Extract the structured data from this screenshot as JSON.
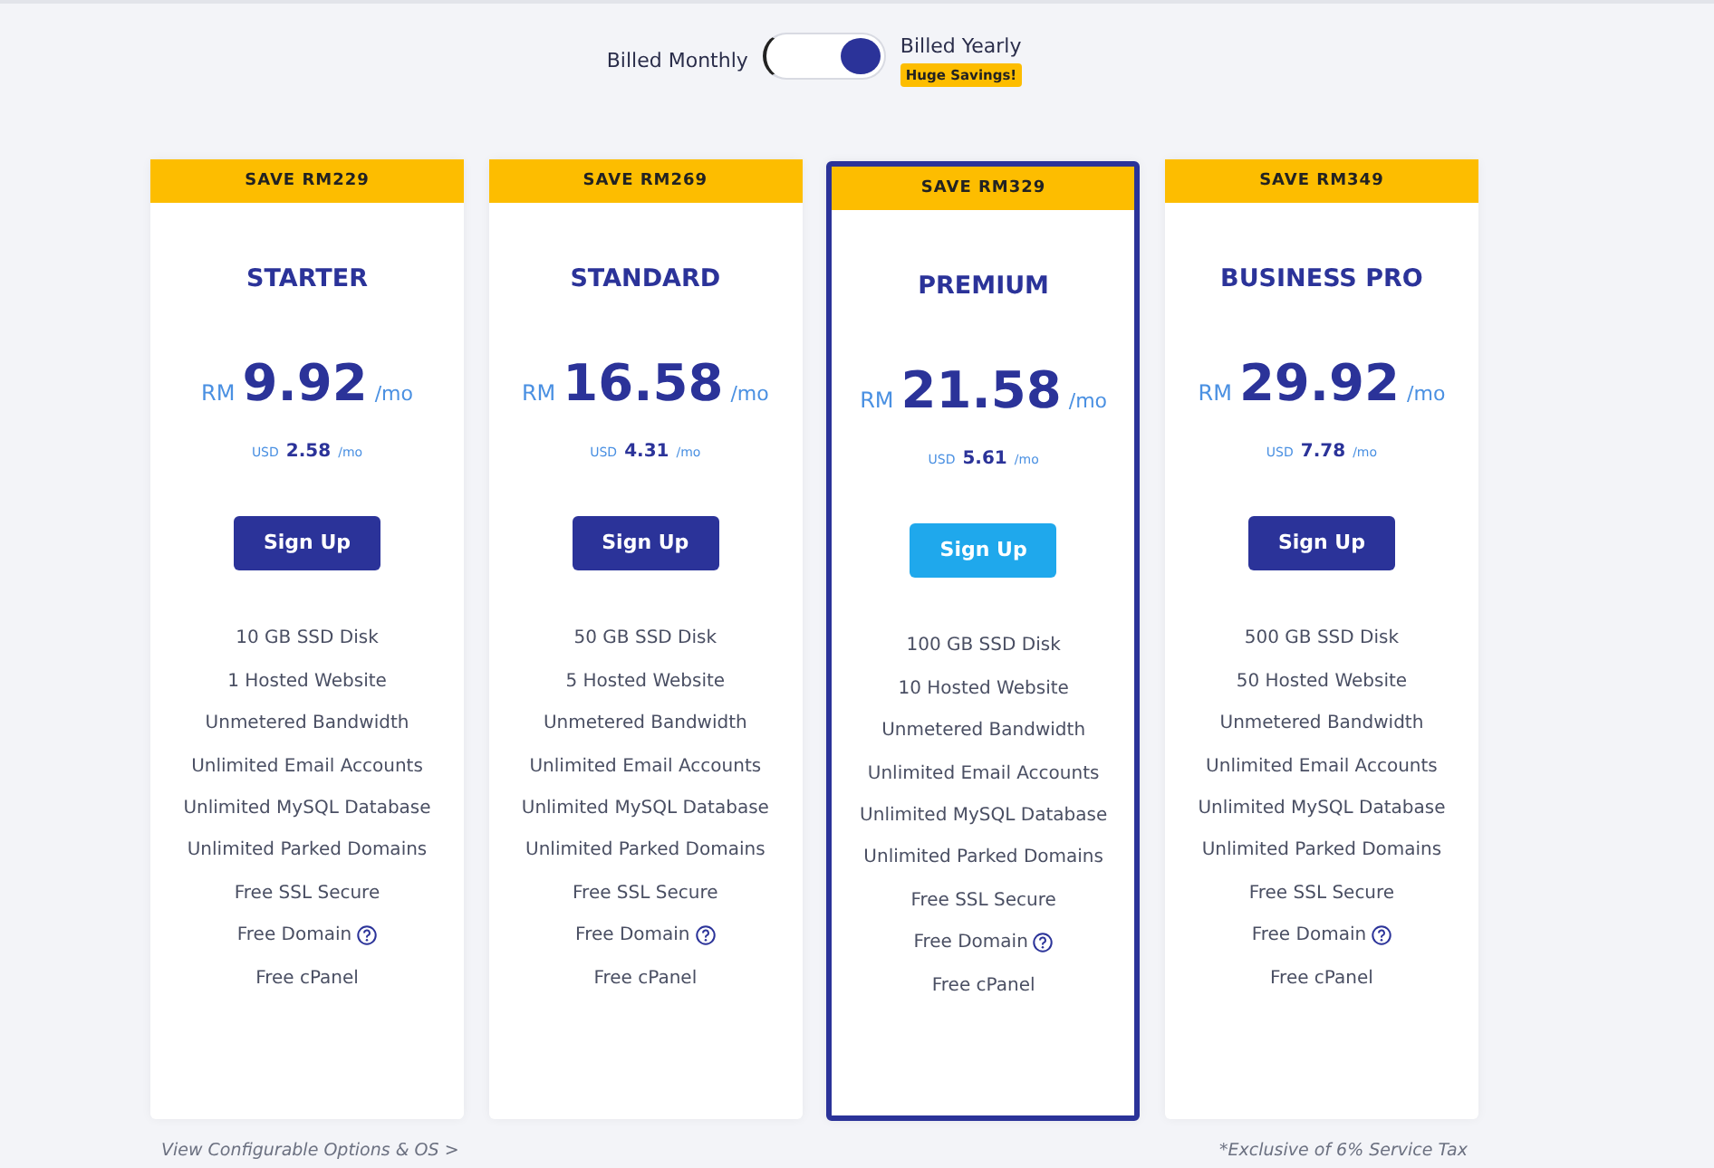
{
  "billing": {
    "monthly_label": "Billed Monthly",
    "yearly_label": "Billed Yearly",
    "yearly_on": true,
    "savings_badge": "Huge Savings!"
  },
  "plans": [
    {
      "save": "SAVE RM229",
      "name": "STARTER",
      "currency": "RM",
      "price": "9.92",
      "period": "/mo",
      "usd_label": "USD",
      "usd_price": "2.58",
      "usd_period": "/mo",
      "button": "Sign Up",
      "selected": false,
      "features": [
        {
          "text": "10 GB SSD Disk",
          "help": false
        },
        {
          "text": "1 Hosted Website",
          "help": false
        },
        {
          "text": "Unmetered Bandwidth",
          "help": false
        },
        {
          "text": "Unlimited Email Accounts",
          "help": false
        },
        {
          "text": "Unlimited MySQL Database",
          "help": false
        },
        {
          "text": "Unlimited Parked Domains",
          "help": false
        },
        {
          "text": "Free SSL Secure",
          "help": false
        },
        {
          "text": "Free Domain",
          "help": true
        },
        {
          "text": "Free cPanel",
          "help": false
        }
      ]
    },
    {
      "save": "SAVE RM269",
      "name": "STANDARD",
      "currency": "RM",
      "price": "16.58",
      "period": "/mo",
      "usd_label": "USD",
      "usd_price": "4.31",
      "usd_period": "/mo",
      "button": "Sign Up",
      "selected": false,
      "features": [
        {
          "text": "50 GB SSD Disk",
          "help": false
        },
        {
          "text": "5 Hosted Website",
          "help": false
        },
        {
          "text": "Unmetered Bandwidth",
          "help": false
        },
        {
          "text": "Unlimited Email Accounts",
          "help": false
        },
        {
          "text": "Unlimited MySQL Database",
          "help": false
        },
        {
          "text": "Unlimited Parked Domains",
          "help": false
        },
        {
          "text": "Free SSL Secure",
          "help": false
        },
        {
          "text": "Free Domain",
          "help": true
        },
        {
          "text": "Free cPanel",
          "help": false
        }
      ]
    },
    {
      "save": "SAVE RM329",
      "name": "PREMIUM",
      "currency": "RM",
      "price": "21.58",
      "period": "/mo",
      "usd_label": "USD",
      "usd_price": "5.61",
      "usd_period": "/mo",
      "button": "Sign Up",
      "selected": true,
      "features": [
        {
          "text": "100 GB SSD Disk",
          "help": false
        },
        {
          "text": "10 Hosted Website",
          "help": false
        },
        {
          "text": "Unmetered Bandwidth",
          "help": false
        },
        {
          "text": "Unlimited Email Accounts",
          "help": false
        },
        {
          "text": "Unlimited MySQL Database",
          "help": false
        },
        {
          "text": "Unlimited Parked Domains",
          "help": false
        },
        {
          "text": "Free SSL Secure",
          "help": false
        },
        {
          "text": "Free Domain",
          "help": true
        },
        {
          "text": "Free cPanel",
          "help": false
        }
      ]
    },
    {
      "save": "SAVE RM349",
      "name": "BUSINESS PRO",
      "currency": "RM",
      "price": "29.92",
      "period": "/mo",
      "usd_label": "USD",
      "usd_price": "7.78",
      "usd_period": "/mo",
      "button": "Sign Up",
      "selected": false,
      "features": [
        {
          "text": "500 GB SSD Disk",
          "help": false
        },
        {
          "text": "50 Hosted Website",
          "help": false
        },
        {
          "text": "Unmetered Bandwidth",
          "help": false
        },
        {
          "text": "Unlimited Email Accounts",
          "help": false
        },
        {
          "text": "Unlimited MySQL Database",
          "help": false
        },
        {
          "text": "Unlimited Parked Domains",
          "help": false
        },
        {
          "text": "Free SSL Secure",
          "help": false
        },
        {
          "text": "Free Domain",
          "help": true
        },
        {
          "text": "Free cPanel",
          "help": false
        }
      ]
    }
  ],
  "footer": {
    "link": "View Configurable Options & OS >",
    "note": "*Exclusive of 6% Service Tax"
  }
}
